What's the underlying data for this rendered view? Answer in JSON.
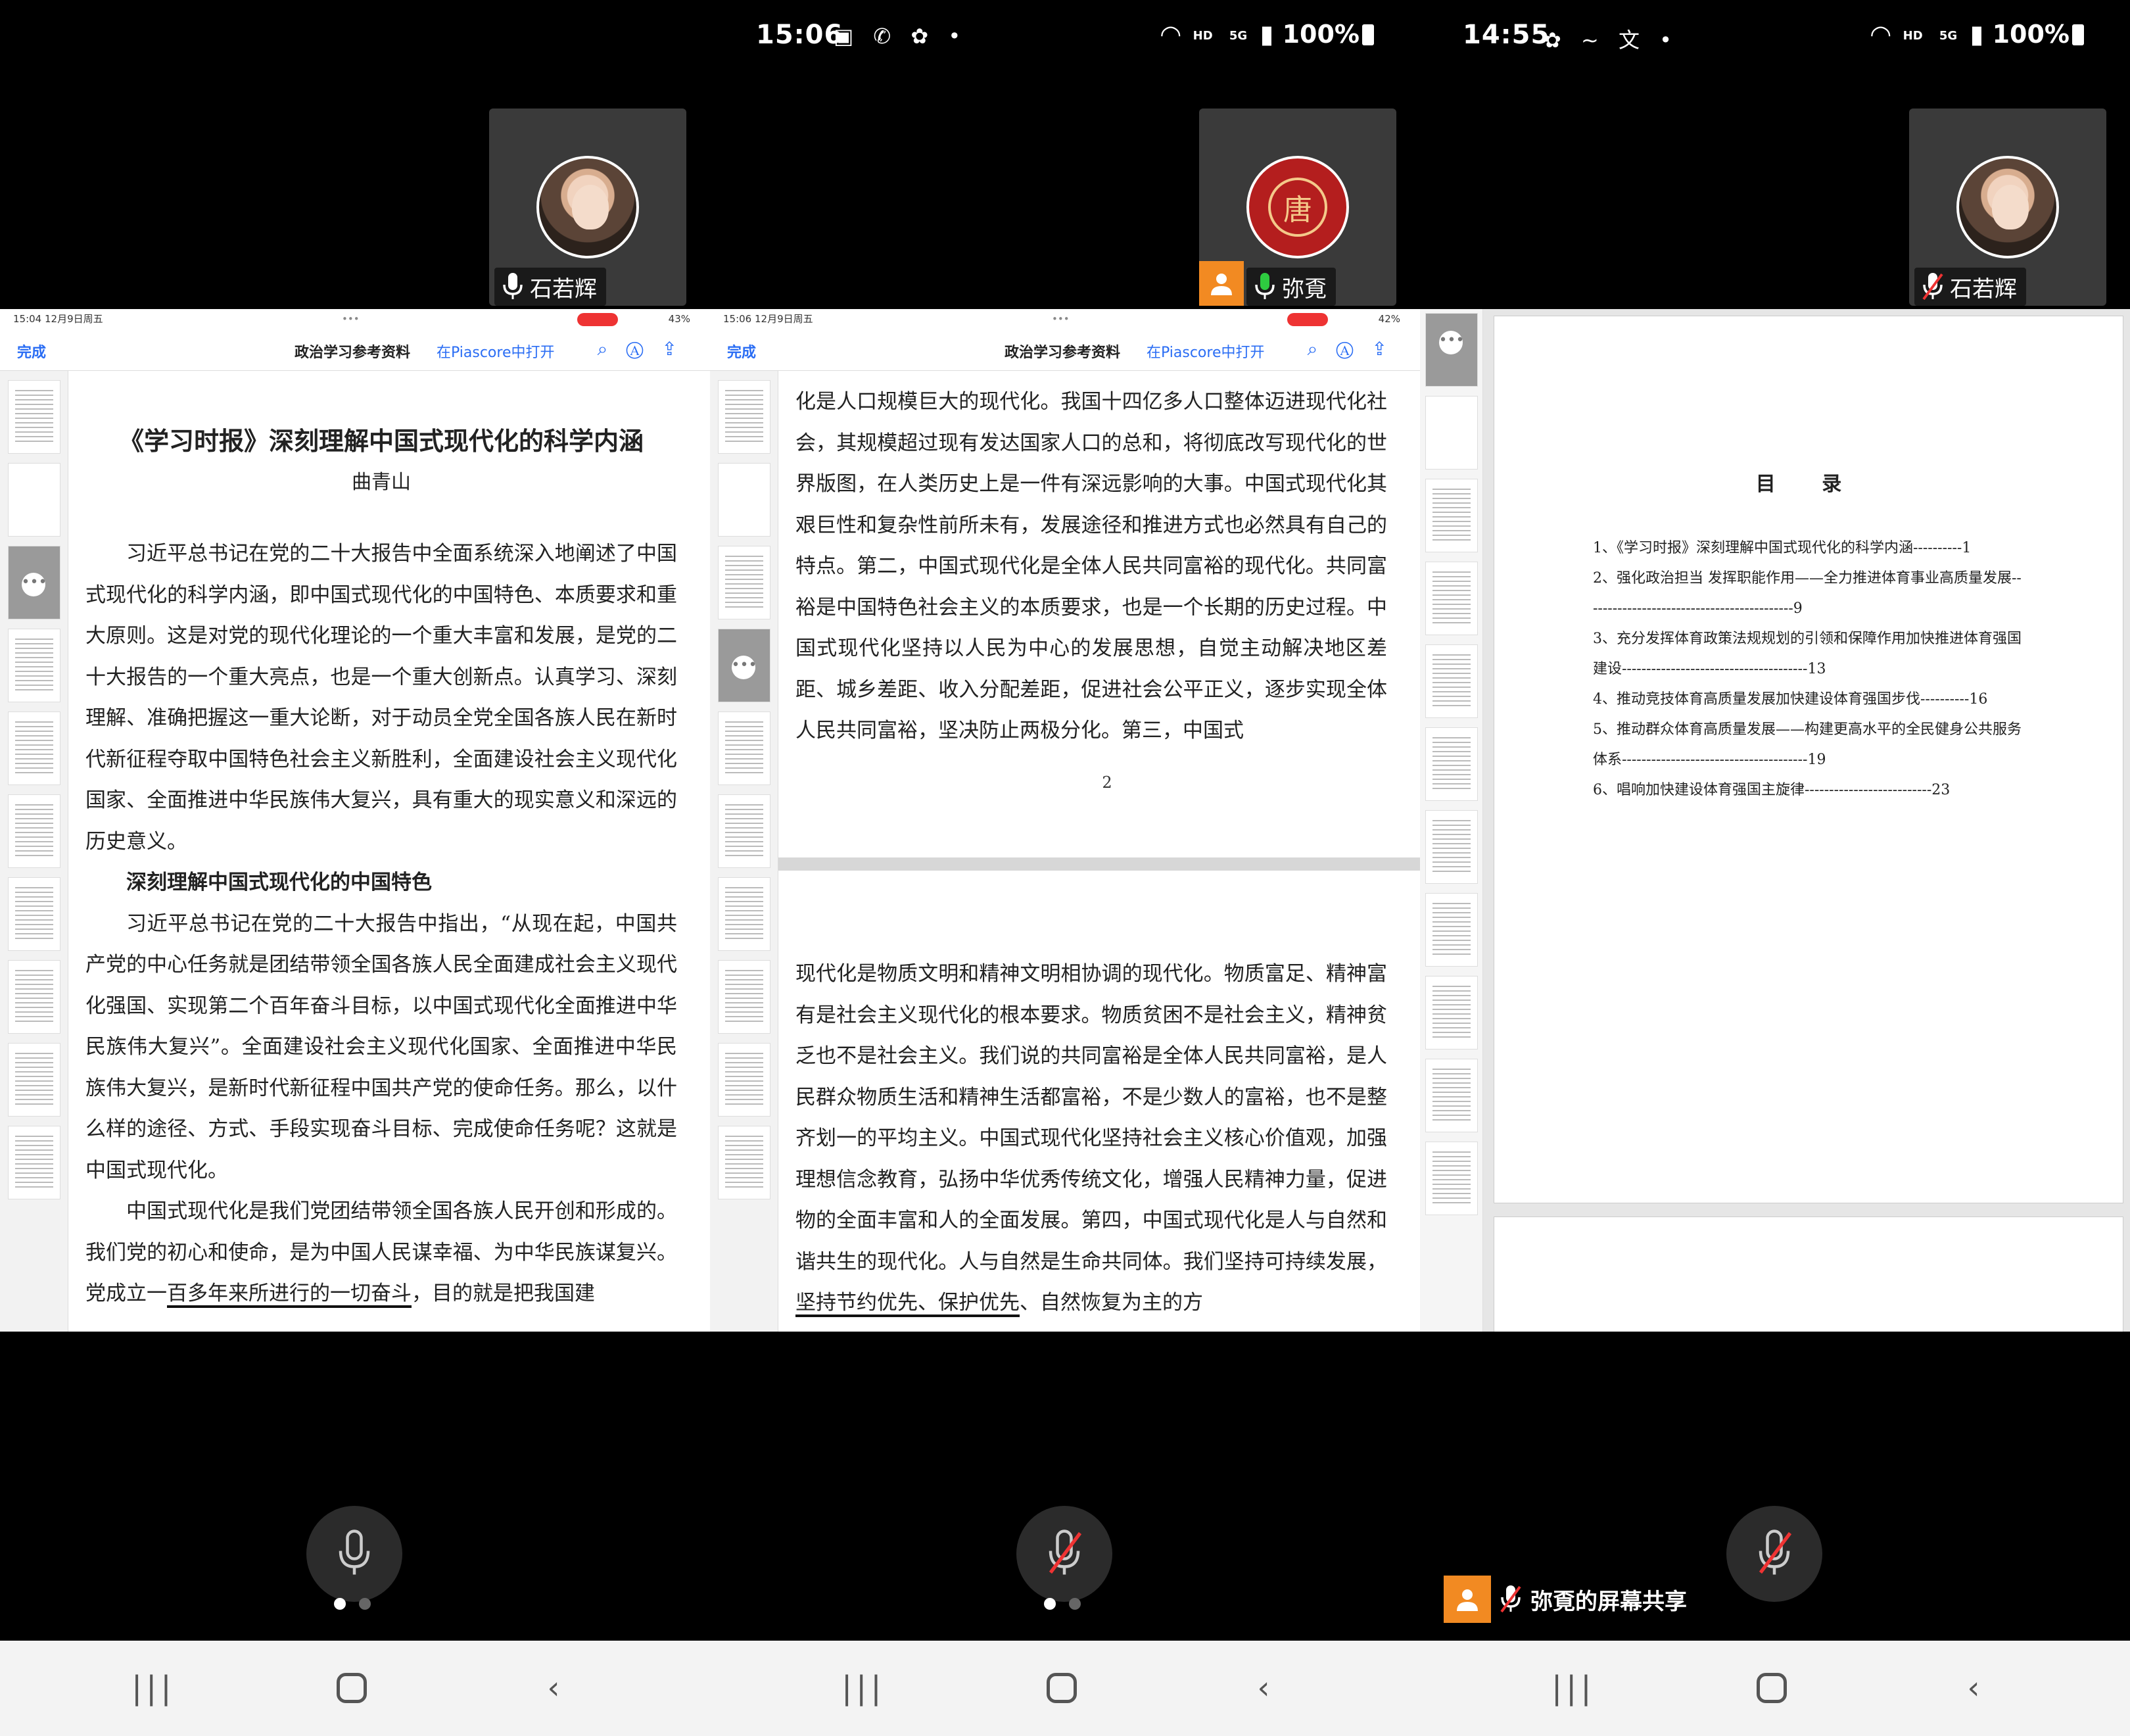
{
  "colors": {
    "accent_blue": "#2a6df4",
    "share_orange": "#f28a22",
    "record_red": "#e33333",
    "tile_bg": "#3a3a3a"
  },
  "screens": [
    {
      "status": {
        "time": "",
        "icons": "",
        "hd": "",
        "signal": "",
        "battery": ""
      },
      "tile": {
        "avatar": "photo",
        "name": "石若辉",
        "mic": "mic-on-icon"
      },
      "ipad": {
        "time": "15:04  12月9日周五",
        "battery": "43%",
        "done": "完成",
        "title": "政治学习参考资料",
        "open_in": "在Piascore中打开"
      },
      "doc": {
        "title": "《学习时报》深刻理解中国式现代化的科学内涵",
        "author": "曲青山",
        "para1": "习近平总书记在党的二十大报告中全面系统深入地阐述了中国式现代化的科学内涵，即中国式现代化的中国特色、本质要求和重大原则。这是对党的现代化理论的一个重大丰富和发展，是党的二十大报告的一个重大亮点，也是一个重大创新点。认真学习、深刻理解、准确把握这一重大论断，对于动员全党全国各族人民在新时代新征程夺取中国特色社会主义新胜利，全面建设社会主义现代化国家、全面推进中华民族伟大复兴，具有重大的现实意义和深远的历史意义。",
        "heading": "深刻理解中国式现代化的中国特色",
        "para2": "习近平总书记在党的二十大报告中指出，“从现在起，中国共产党的中心任务就是团结带领全国各族人民全面建成社会主义现代化强国、实现第二个百年奋斗目标，以中国式现代化全面推进中华民族伟大复兴”。全面建设社会主义现代化国家、全面推进中华民族伟大复兴，是新时代新征程中国共产党的使命任务。那么，以什么样的途径、方式、手段实现奋斗目标、完成使命任务呢？这就是中国式现代化。",
        "para3_a": "中国式现代化是我们党团结带领全国各族人民开创和形成的。我们党的初心和使命，是为中国人民谋幸福、为中华民族谋复兴。党成立一",
        "para3_u": "百多年来所进行的一切奋斗",
        "para3_b": "，目的就是把我国建"
      },
      "dots": 2,
      "active_dot": 0
    },
    {
      "status": {
        "time": "15:06",
        "icons": "▣ ✆ ✿ •",
        "hd": "HD",
        "signal": "5G",
        "battery": "100%"
      },
      "tile": {
        "avatar": "logo",
        "logo_char": "唐",
        "name": "弥覔",
        "mic": "mic-on-icon"
      },
      "ipad": {
        "time": "15:06  12月9日周五",
        "battery": "42%",
        "done": "完成",
        "title": "政治学习参考资料",
        "open_in": "在Piascore中打开"
      },
      "doc": {
        "text_top": "化是人口规模巨大的现代化。我国十四亿多人口整体迈进现代化社会，其规模超过现有发达国家人口的总和，将彻底改写现代化的世界版图，在人类历史上是一件有深远影响的大事。中国式现代化其艰巨性和复杂性前所未有，发展途径和推进方式也必然具有自己的特点。第二，中国式现代化是全体人民共同富裕的现代化。共同富裕是中国特色社会主义的本质要求，也是一个长期的历史过程。中国式现代化坚持以人民为中心的发展思想，自觉主动解决地区差距、城乡差距、收入分配差距，促进社会公平正义，逐步实现全体人民共同富裕，坚决防止两极分化。第三，中国式",
        "page_number": "2",
        "text_bottom_a": "现代化是物质文明和精神文明相协调的现代化。物质富足、精神富有是社会主义现代化的根本要求。物质贫困不是社会主义，精神贫乏也不是社会主义。我们说的共同富裕是全体人民共同富裕，是人民群众物质生活和精神生活都富裕，不是少数人的富裕，也不是整齐划一的平均主义。中国式现代化坚持社会主义核心价值观，加强理想信念教育，弘扬中华优秀传统文化，增强人民精神力量，促进物的全面丰富和人的全面发展。第四，中国式现代化是人与自然和谐共生的现代化。人与自然是生命共同体。我们坚持可持续发展，",
        "text_bottom_u": "坚持节约优先、保护优先",
        "text_bottom_b": "、自然恢复为主的方"
      },
      "dots": 2,
      "active_dot": 0
    },
    {
      "status": {
        "time": "14:55",
        "icons": "✿ ∼ 文 •",
        "hd": "HD",
        "signal": "5G",
        "battery": "100%"
      },
      "tile": {
        "avatar": "photo",
        "name": "石若辉",
        "mic": "mic-off-icon"
      },
      "toc": {
        "title": "目 录",
        "items": [
          "1、《学习时报》深刻理解中国式现代化的科学内涵----------1",
          "2、强化政治担当  发挥职能作用——全力推进体育事业高质量发展-------------------------------------------9",
          "3、充分发挥体育政策法规规划的引领和保障作用加快推进体育强国建设--------------------------------------13",
          "4、推动竞技体育高质量发展加快建设体育强国步伐----------16",
          "5、推动群众体育高质量发展——构建更高水平的全民健身公共服务体系--------------------------------------19",
          "6、唱响加快建设体育强国主旋律--------------------------23"
        ]
      },
      "share_label": "弥覔的屏幕共享"
    }
  ],
  "nav": {
    "recent": "|||",
    "home": "home",
    "back": "‹"
  }
}
